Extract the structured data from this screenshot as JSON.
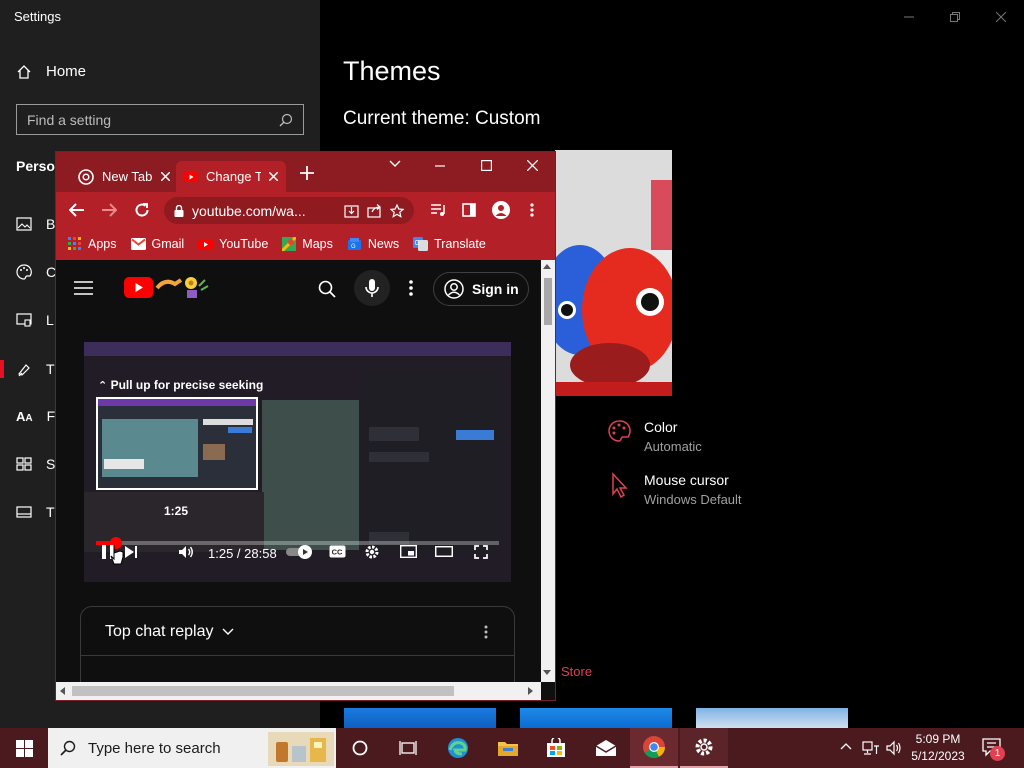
{
  "settings": {
    "window_title": "Settings",
    "home_label": "Home",
    "search_placeholder": "Find a setting",
    "section_heading": "Perso",
    "nav_items": [
      {
        "label": "B",
        "icon": "image-icon"
      },
      {
        "label": "C",
        "icon": "palette-icon"
      },
      {
        "label": "L",
        "icon": "lock-screen-icon"
      },
      {
        "label": "T",
        "icon": "brush-icon"
      },
      {
        "label": "F",
        "icon": "font-icon"
      },
      {
        "label": "S",
        "icon": "start-icon"
      },
      {
        "label": "T",
        "icon": "taskbar-icon"
      }
    ],
    "page_title": "Themes",
    "current_theme": "Current theme: Custom",
    "options": [
      {
        "name": "Color",
        "value": "Automatic",
        "icon": "palette-icon"
      },
      {
        "name": "Mouse cursor",
        "value": "Windows Default",
        "icon": "cursor-icon"
      }
    ],
    "store_link": "Store",
    "accent_color": "#e81123"
  },
  "chrome": {
    "tabs": [
      {
        "title": "New Tab",
        "active": false
      },
      {
        "title": "Change T",
        "active": true
      }
    ],
    "url": "youtube.com/wa...",
    "bookmarks": [
      {
        "label": "Apps",
        "color": "#4285f4"
      },
      {
        "label": "Gmail",
        "color": "#ea4335"
      },
      {
        "label": "YouTube",
        "color": "#ff0000"
      },
      {
        "label": "Maps",
        "color": "#34a853"
      },
      {
        "label": "News",
        "color": "#1a73e8"
      },
      {
        "label": "Translate",
        "color": "#4285f4"
      }
    ],
    "theme_color": "#b32027"
  },
  "youtube": {
    "signin_label": "Sign in",
    "seek_hint": "Pull up for precise seeking",
    "seek_time": "1:25",
    "time_display": "1:25 / 28:58",
    "progress_fraction": 0.049,
    "chat_title": "Top chat replay"
  },
  "taskbar": {
    "search_placeholder": "Type here to search",
    "time": "5:09 PM",
    "date": "5/12/2023",
    "notification_count": "1"
  }
}
